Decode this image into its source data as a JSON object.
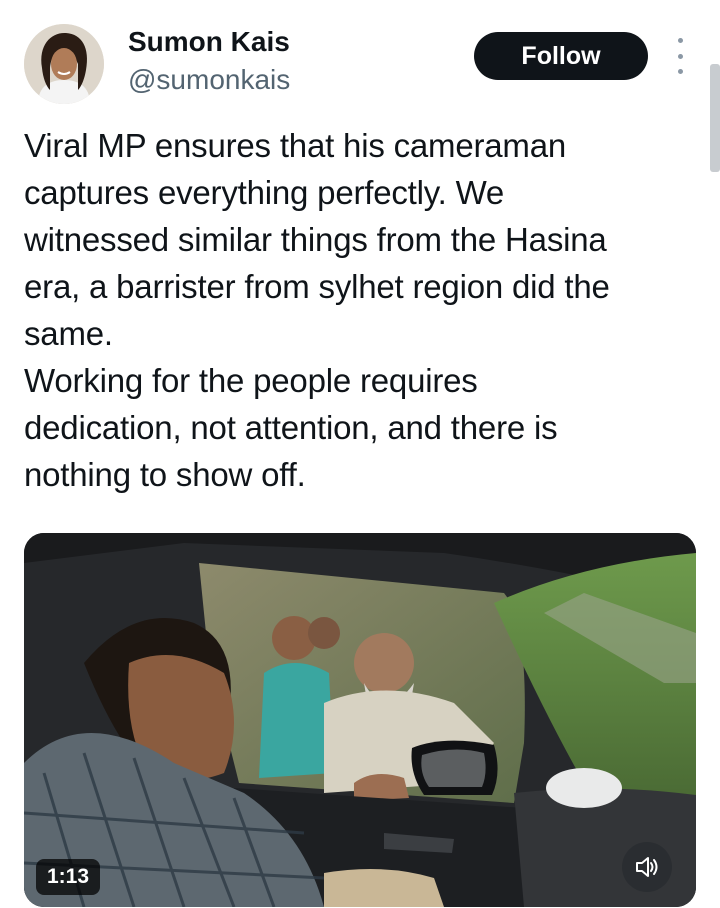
{
  "author": {
    "name": "Sumon Kais",
    "handle": "@sumonkais"
  },
  "actions": {
    "follow_label": "Follow",
    "more_icon": "more-vertical-icon"
  },
  "tweet": {
    "text": "Viral MP ensures that his cameraman\ncaptures everything perfectly. We\nwitnessed similar things from the Hasina\nera, a barrister from sylhet region did the\nsame.\nWorking for the people requires\ndedication, not attention, and there is\nnothing to show off."
  },
  "video": {
    "duration": "1:13",
    "sound_icon": "speaker-muted-icon"
  },
  "colors": {
    "text": "#0f1419",
    "secondary": "#536471",
    "button_bg": "#0f1419"
  }
}
